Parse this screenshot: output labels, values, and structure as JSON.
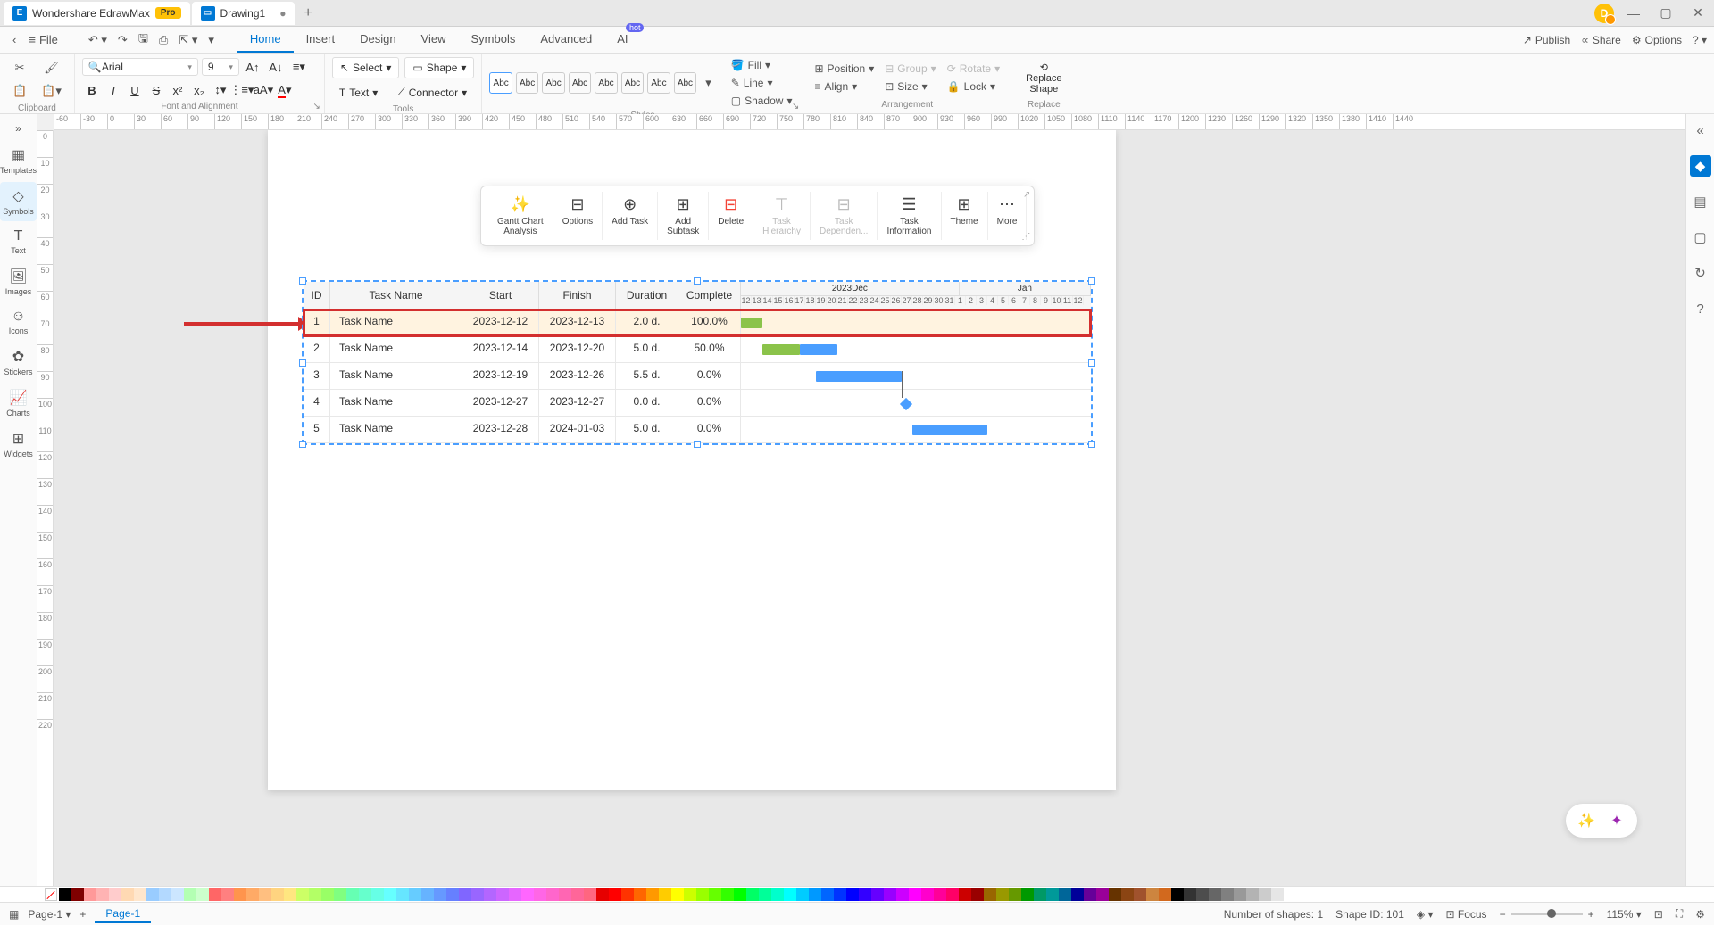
{
  "titleBar": {
    "appTab": "Wondershare EdrawMax",
    "proBadge": "Pro",
    "docTab": "Drawing1",
    "userInitial": "D"
  },
  "menuBar": {
    "file": "File",
    "tabs": [
      "Home",
      "Insert",
      "Design",
      "View",
      "Symbols",
      "Advanced",
      "AI"
    ],
    "hotBadge": "hot",
    "right": {
      "publish": "Publish",
      "share": "Share",
      "options": "Options"
    }
  },
  "ribbon": {
    "clipboard": "Clipboard",
    "font": {
      "name": "Arial",
      "size": "9",
      "label": "Font and Alignment"
    },
    "tools": {
      "select": "Select",
      "shape": "Shape",
      "text": "Text",
      "connector": "Connector",
      "label": "Tools"
    },
    "styles": {
      "label": "Styles",
      "swatch": "Abc"
    },
    "arrangement": {
      "fill": "Fill",
      "line": "Line",
      "shadow": "Shadow",
      "position": "Position",
      "align": "Align",
      "group": "Group",
      "size": "Size",
      "rotate": "Rotate",
      "lock": "Lock",
      "label": "Arrangement"
    },
    "replace": {
      "button": "Replace\nShape",
      "label": "Replace"
    }
  },
  "leftSidebar": {
    "items": [
      {
        "label": "Templates"
      },
      {
        "label": "Symbols"
      },
      {
        "label": "Text"
      },
      {
        "label": "Images"
      },
      {
        "label": "Icons"
      },
      {
        "label": "Stickers"
      },
      {
        "label": "Charts"
      },
      {
        "label": "Widgets"
      }
    ]
  },
  "floatToolbar": {
    "items": [
      {
        "label": "Gantt Chart\nAnalysis"
      },
      {
        "label": "Options"
      },
      {
        "label": "Add Task"
      },
      {
        "label": "Add\nSubtask"
      },
      {
        "label": "Delete"
      },
      {
        "label": "Task\nHierarchy"
      },
      {
        "label": "Task\nDependen..."
      },
      {
        "label": "Task\nInformation"
      },
      {
        "label": "Theme"
      },
      {
        "label": "More"
      }
    ]
  },
  "gantt": {
    "headers": {
      "id": "ID",
      "name": "Task Name",
      "start": "Start",
      "finish": "Finish",
      "duration": "Duration",
      "complete": "Complete"
    },
    "months": {
      "dec": "2023Dec",
      "jan": "Jan"
    },
    "days": [
      "12",
      "13",
      "14",
      "15",
      "16",
      "17",
      "18",
      "19",
      "20",
      "21",
      "22",
      "23",
      "24",
      "25",
      "26",
      "27",
      "28",
      "29",
      "30",
      "31",
      "1",
      "2",
      "3",
      "4",
      "5",
      "6",
      "7",
      "8",
      "9",
      "10",
      "11",
      "12"
    ],
    "rows": [
      {
        "id": "1",
        "name": "Task Name",
        "start": "2023-12-12",
        "finish": "2023-12-13",
        "duration": "2.0 d.",
        "complete": "100.0%"
      },
      {
        "id": "2",
        "name": "Task Name",
        "start": "2023-12-14",
        "finish": "2023-12-20",
        "duration": "5.0 d.",
        "complete": "50.0%"
      },
      {
        "id": "3",
        "name": "Task Name",
        "start": "2023-12-19",
        "finish": "2023-12-26",
        "duration": "5.5 d.",
        "complete": "0.0%"
      },
      {
        "id": "4",
        "name": "Task Name",
        "start": "2023-12-27",
        "finish": "2023-12-27",
        "duration": "0.0 d.",
        "complete": "0.0%"
      },
      {
        "id": "5",
        "name": "Task Name",
        "start": "2023-12-28",
        "finish": "2024-01-03",
        "duration": "5.0 d.",
        "complete": "0.0%"
      }
    ]
  },
  "statusBar": {
    "pageSelect": "Page-1",
    "pageTab": "Page-1",
    "shapes": "Number of shapes: 1",
    "shapeId": "Shape ID: 101",
    "focus": "Focus",
    "zoom": "115%"
  },
  "colors": [
    "#000000",
    "#7f0000",
    "#ff9999",
    "#ffb3b3",
    "#ffcccc",
    "#ffd9b3",
    "#ffe6cc",
    "#99ccff",
    "#b3d9ff",
    "#cce6ff",
    "#b3ffb3",
    "#ccffcc",
    "#ff6666",
    "#ff8080",
    "#ff944d",
    "#ffaa66",
    "#ffbf80",
    "#ffd480",
    "#ffe680",
    "#ccff66",
    "#b3ff66",
    "#99ff66",
    "#80ff80",
    "#66ffb3",
    "#66ffcc",
    "#66ffe6",
    "#66ffff",
    "#66e6ff",
    "#66ccff",
    "#66b3ff",
    "#6699ff",
    "#6680ff",
    "#8066ff",
    "#9966ff",
    "#b366ff",
    "#cc66ff",
    "#e666ff",
    "#ff66ff",
    "#ff66e6",
    "#ff66cc",
    "#ff66b3",
    "#ff6699",
    "#ff6680",
    "#e60000",
    "#ff0000",
    "#ff3300",
    "#ff6600",
    "#ff9900",
    "#ffcc00",
    "#ffff00",
    "#ccff00",
    "#99ff00",
    "#66ff00",
    "#33ff00",
    "#00ff00",
    "#00ff66",
    "#00ff99",
    "#00ffcc",
    "#00ffff",
    "#00ccff",
    "#0099ff",
    "#0066ff",
    "#0033ff",
    "#0000ff",
    "#3300ff",
    "#6600ff",
    "#9900ff",
    "#cc00ff",
    "#ff00ff",
    "#ff00cc",
    "#ff0099",
    "#ff0066",
    "#cc0000",
    "#990000",
    "#996600",
    "#999900",
    "#669900",
    "#009900",
    "#009966",
    "#009999",
    "#006699",
    "#000099",
    "#660099",
    "#990099",
    "#663300",
    "#8b4513",
    "#a0522d",
    "#cd853f",
    "#d2691e",
    "#000000",
    "#333333",
    "#4d4d4d",
    "#666666",
    "#808080",
    "#999999",
    "#b3b3b3",
    "#cccccc",
    "#e6e6e6",
    "#ffffff"
  ]
}
